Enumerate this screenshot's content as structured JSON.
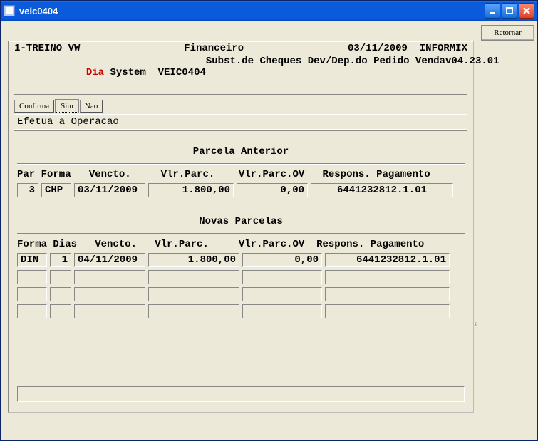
{
  "window": {
    "title": "veic0404"
  },
  "right": {
    "retornar": "Retornar"
  },
  "header": {
    "line1_left": "1-TREINO VW",
    "line1_mid": "Financeiro",
    "line1_date": "03/11/2009",
    "line1_right": "INFORMIX",
    "line2_dia": "Dia",
    "line2_system": " System  VEIC0404",
    "line2_desc": "Subst.de Cheques Dev/Dep.do Pedido Venda",
    "line2_ver": "v04.23.01"
  },
  "toolbar": {
    "confirma": "Confirma",
    "sim": "Sim",
    "nao": "Nao"
  },
  "section": {
    "efetua": "Efetua a Operacao",
    "parcela_anterior": "Parcela Anterior",
    "novas_parcelas": "Novas Parcelas"
  },
  "anterior": {
    "headers": "Par Forma   Vencto.     Vlr.Parc.    Vlr.Parc.OV   Respons. Pagamento",
    "row": {
      "par": "3",
      "forma": "CHP",
      "vencto": "03/11/2009",
      "vlr_parc": "1.800,00",
      "vlr_parc_ov": "0,00",
      "respons": "6441232812.1.01"
    }
  },
  "novas": {
    "headers": "Forma Dias   Vencto.   Vlr.Parc.     Vlr.Parc.OV  Respons. Pagamento",
    "rows": [
      {
        "forma": "DIN",
        "dias": "1",
        "vencto": "04/11/2009",
        "vlr_parc": "1.800,00",
        "vlr_parc_ov": "0,00",
        "respons": "6441232812.1.01"
      },
      {
        "forma": "",
        "dias": "",
        "vencto": "",
        "vlr_parc": "",
        "vlr_parc_ov": "",
        "respons": ""
      },
      {
        "forma": "",
        "dias": "",
        "vencto": "",
        "vlr_parc": "",
        "vlr_parc_ov": "",
        "respons": ""
      },
      {
        "forma": "",
        "dias": "",
        "vencto": "",
        "vlr_parc": "",
        "vlr_parc_ov": "",
        "respons": ""
      }
    ]
  }
}
